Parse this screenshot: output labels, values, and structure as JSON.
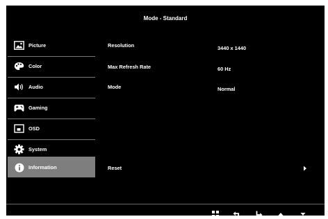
{
  "header": {
    "title": "Mode - Standard"
  },
  "sidebar": {
    "items": [
      {
        "label": "Picture",
        "icon": "picture-icon"
      },
      {
        "label": "Color",
        "icon": "palette-icon"
      },
      {
        "label": "Audio",
        "icon": "speaker-icon"
      },
      {
        "label": "Gaming",
        "icon": "gamepad-icon"
      },
      {
        "label": "OSD",
        "icon": "osd-window-icon"
      },
      {
        "label": "System",
        "icon": "gear-icon"
      },
      {
        "label": "Information",
        "icon": "info-icon"
      }
    ],
    "active": "Information"
  },
  "info": {
    "resolution": {
      "label": "Resolution",
      "value": "3440 x 1440"
    },
    "refresh": {
      "label": "Max Refresh Rate",
      "value": "60 Hz"
    },
    "mode": {
      "label": "Mode",
      "value": "Normal"
    },
    "reset": {
      "label": "Reset"
    }
  },
  "footer": {
    "buttons": [
      "grid-menu-icon",
      "return-icon",
      "enter-icon",
      "up-arrow-icon",
      "down-arrow-icon"
    ]
  },
  "colors": {
    "background": "#000000",
    "text": "#ffffff",
    "active": "#7e7e7e"
  }
}
